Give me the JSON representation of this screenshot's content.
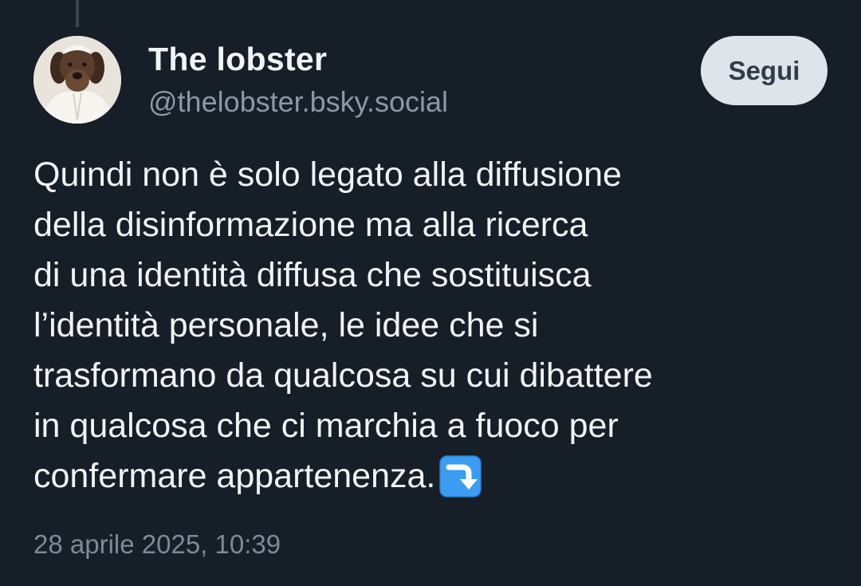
{
  "post": {
    "author": {
      "display_name": "The lobster",
      "handle": "@thelobster.bsky.social"
    },
    "follow_label": "Segui",
    "text_lines": [
      "Quindi non è solo legato alla diffusione",
      "della disinformazione ma alla ricerca",
      "di una identità diffusa che sostituisca",
      "l’identità personale, le idee che si",
      "trasformano da qualcosa su cui dibattere",
      "in qualcosa che ci marchia a fuoco per",
      "confermare appartenenza."
    ],
    "trailing_emoji": "right-arrow-curving-down-icon",
    "timestamp": "28 aprile 2025, 10:39"
  },
  "colors": {
    "background": "#161e27",
    "text": "#f1f3f5",
    "muted": "#8b98a5",
    "follow_button_bg": "#dfe4ea",
    "emoji_blue": "#3b9cf2"
  }
}
